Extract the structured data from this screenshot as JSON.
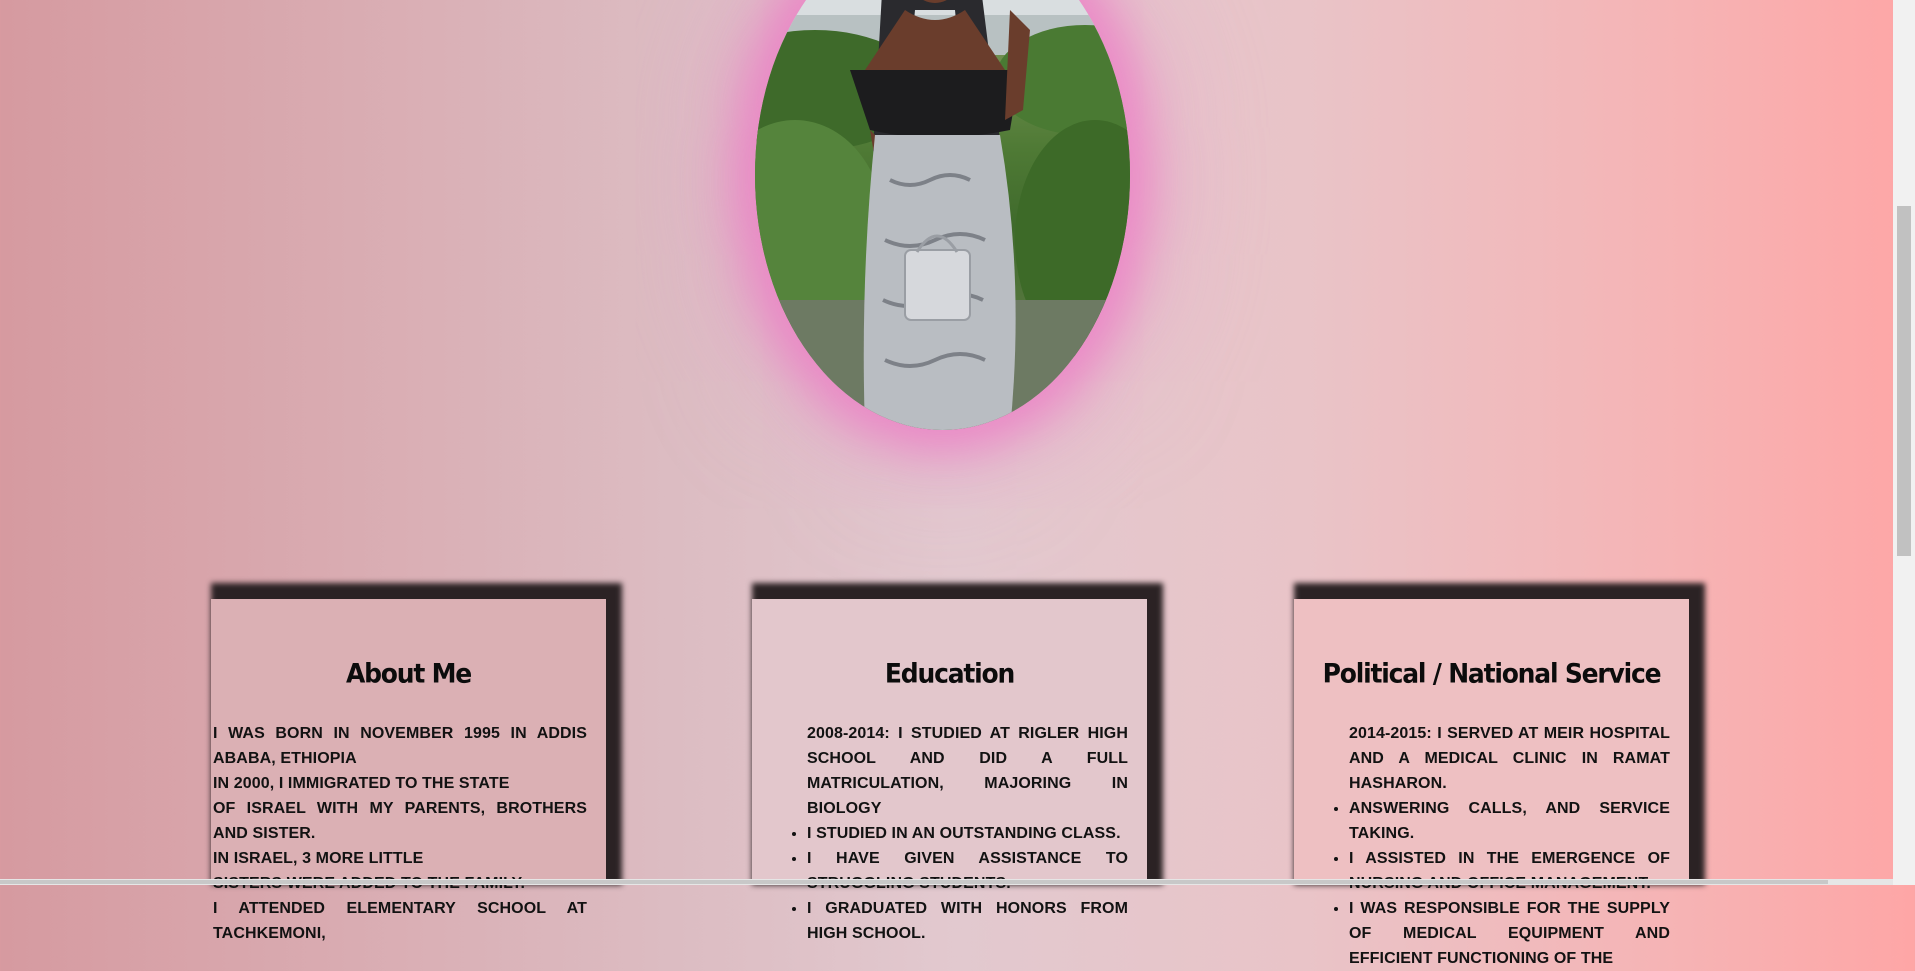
{
  "profile": {
    "photo_alt": "Profile photo"
  },
  "cards": [
    {
      "title": "About Me",
      "paragraphs": [
        "I was born in November 1995 in Addis Ababa, Ethiopia",
        "In 2000, I immigrated to the state",
        "of Israel with my parents, brothers and sister.",
        "In Israel, 3 more little",
        "sisters were added to the family.",
        "I attended elementary school at Tachkemoni,"
      ]
    },
    {
      "title": "Education",
      "intro": "2008-2014: I studied at Rigler High School and did a full matriculation, majoring in Biology",
      "items": [
        "I studied in an outstanding class.",
        "I have given assistance to struggling students.",
        "I graduated with honors from high school."
      ]
    },
    {
      "title": "Political / National Service",
      "intro": "2014-2015: I served at Meir Hospital and a medical clinic in Ramat Hasharon.",
      "items": [
        "Answering calls, and service taking.",
        "I assisted in the emergence of nursing and office management.",
        "I was responsible for the supply of medical equipment and efficient functioning of the"
      ]
    }
  ],
  "colors": {
    "glow": "#ec78c4",
    "card_shadow": "#2b2224",
    "text": "#121212"
  }
}
